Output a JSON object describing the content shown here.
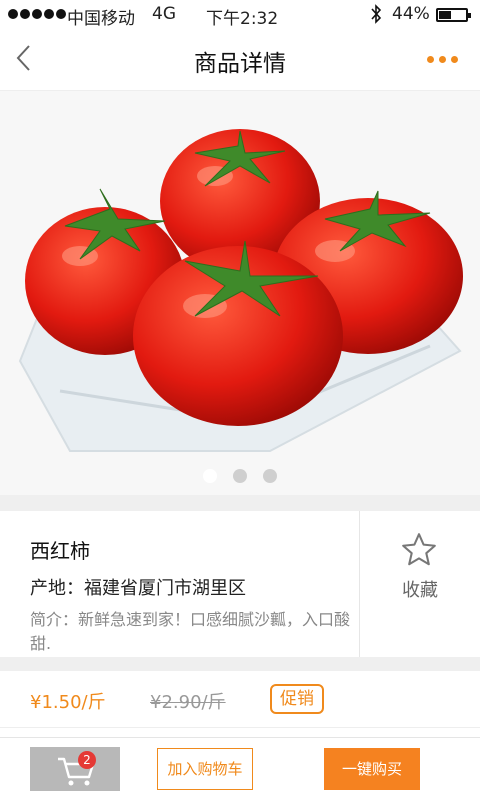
{
  "status_bar": {
    "carrier": "中国移动",
    "network": "4G",
    "time": "下午2:32",
    "bluetooth_icon": "bluetooth-icon",
    "battery_percent": "44%",
    "battery_level": 0.44
  },
  "nav": {
    "title": "商品详情",
    "back_icon": "chevron-left-icon",
    "more_icon": "more-dots-icon",
    "accent": "#f08a1c"
  },
  "gallery": {
    "image_subject": "tomatoes",
    "page_count": 3,
    "active_index": 0
  },
  "product": {
    "name": "西红柿",
    "origin": "产地：福建省厦门市湖里区",
    "description": "简介：新鲜急速到家！口感细腻沙瓤，入口酸甜.",
    "favorite_label": "收藏",
    "favorite_icon": "star-outline-icon"
  },
  "pricing": {
    "price": "¥1.50/斤",
    "original_price": "¥2.90/斤",
    "promo_tag": "促销",
    "price_color": "#f08a1c"
  },
  "bottom_bar": {
    "cart_icon": "cart-icon",
    "cart_badge": "2",
    "add_to_cart": "加入购物车",
    "buy_now": "一键购买",
    "button_color": "#f58220"
  }
}
